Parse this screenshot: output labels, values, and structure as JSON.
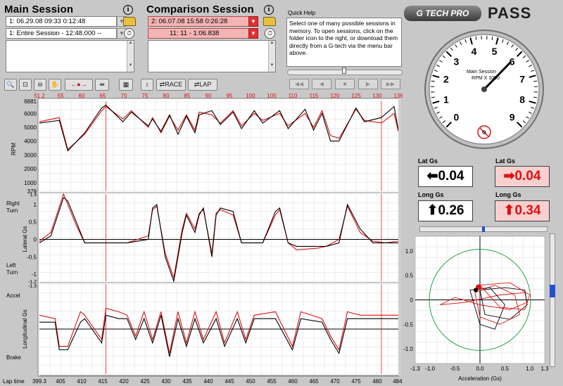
{
  "main_session": {
    "title": "Main Session",
    "session_value": "1:  06.29.08 09:33 0:12:48",
    "range_value": "1:  Entire Session - 12:48.000 --"
  },
  "comparison_session": {
    "title": "Comparison Session",
    "session_value": "2:  06.07.08 15:58 0:26:28",
    "range_value": "11:  11 - 1:06.838"
  },
  "quick_help": {
    "label": "Quick Help",
    "text": "Select one of many possible sessions in memory.  To open sessions, click on the folder icon to the right, or download them directly from a G-tech via the menu bar above."
  },
  "brand": {
    "logo": "G TECH PRO",
    "product": "PASS"
  },
  "toolbar": {
    "race_label": "RACE",
    "lap_label": "LAP"
  },
  "gauge": {
    "line1": "Main Session",
    "line2": "RPM X 1000",
    "ticks": [
      "0",
      "1",
      "2",
      "3",
      "4",
      "5",
      "6",
      "7",
      "8",
      "9"
    ]
  },
  "gs": {
    "lat_label": "Lat Gs",
    "long_label": "Long Gs",
    "main_lat": "0.04",
    "main_long": "0.26",
    "comp_lat": "0.04",
    "comp_long": "0.34",
    "colors": {
      "main": "#000000",
      "comparison": "#e01010"
    }
  },
  "top_axis": [
    "51.2",
    "55",
    "60",
    "65",
    "70",
    "75",
    "80",
    "85",
    "90",
    "95",
    "100",
    "105",
    "110",
    "115",
    "120",
    "125",
    "130",
    "136"
  ],
  "bottom_axis": [
    "399.3",
    "405",
    "410",
    "415",
    "420",
    "425",
    "430",
    "435",
    "440",
    "445",
    "450",
    "455",
    "460",
    "465",
    "470",
    "475",
    "480",
    "484."
  ],
  "bottom_axis_title": "Lap time",
  "rpm_panel": {
    "ylabel": "RPM",
    "ticks": [
      "6881",
      "6000",
      "5000",
      "4000",
      "3000",
      "2000",
      "1000",
      "379"
    ]
  },
  "lat_panel": {
    "ylabel": "Lateral Gs",
    "top_tick": "1.3",
    "bottom_tick": "-1.2",
    "ticks": [
      "1",
      "0.5",
      "0",
      "-0.5",
      "-1"
    ],
    "label_top_1": "Right",
    "label_top_2": "Turn",
    "label_bot_1": "Left",
    "label_bot_2": "Turn"
  },
  "long_panel": {
    "ylabel": "Longitudinal Gs",
    "top_tick": "-1.3",
    "label_top": "Accel",
    "label_bot": "Brake"
  },
  "friction_circle": {
    "xlabel": "Acceleration (Gs)",
    "xticks": [
      "-1.3",
      "-1.0",
      "-0.5",
      "0.0",
      "0.5",
      "1.0",
      "1.3"
    ],
    "yticks": [
      "1.0",
      "0.5",
      "0",
      "-0.5",
      "-1.0"
    ]
  },
  "chart_data": {
    "type": "line",
    "x_label": "Lap time",
    "x_range": [
      399.3,
      484
    ],
    "series": [
      {
        "name": "Main Session",
        "color": "#000000"
      },
      {
        "name": "Comparison Session",
        "color": "#e01010"
      }
    ],
    "rpm": {
      "ylim": [
        379,
        6881
      ],
      "x": [
        399.3,
        404,
        406,
        410,
        414,
        415,
        419,
        421,
        425,
        426,
        428,
        430,
        432,
        434,
        436,
        437,
        440,
        442,
        445,
        447,
        450,
        452,
        456,
        458,
        462,
        464,
        466,
        468,
        470,
        474,
        476,
        480,
        483,
        484
      ],
      "main": [
        5300,
        5500,
        3300,
        4600,
        6400,
        6600,
        5400,
        6100,
        5100,
        5600,
        4700,
        5900,
        4500,
        5800,
        4600,
        5900,
        6200,
        5200,
        6100,
        4900,
        6200,
        5300,
        6200,
        4900,
        6300,
        4800,
        6000,
        4000,
        4000,
        6400,
        5400,
        5700,
        6500,
        4800
      ],
      "comparison": [
        5400,
        5700,
        3400,
        4500,
        6200,
        6500,
        5600,
        6200,
        5000,
        5700,
        4600,
        5800,
        4800,
        5900,
        4800,
        6100,
        5900,
        5300,
        6200,
        5100,
        6000,
        5500,
        6000,
        5100,
        6000,
        5000,
        6200,
        4400,
        4200,
        6300,
        5500,
        5300,
        6000,
        4700
      ]
    },
    "lateral_gs": {
      "ylim": [
        -1.2,
        1.3
      ],
      "x": [
        399.3,
        402,
        405,
        406,
        408,
        410,
        414,
        420,
        425,
        426,
        427,
        429,
        431,
        433,
        434,
        436,
        437,
        438,
        440,
        441,
        442,
        445,
        447,
        450,
        452,
        455,
        456,
        458,
        460,
        465,
        467,
        470,
        472,
        475,
        478,
        481,
        484
      ],
      "main": [
        -0.1,
        0.1,
        1.2,
        1.1,
        0.5,
        -0.1,
        -0.1,
        -0.1,
        0,
        0.9,
        1.0,
        -0.5,
        -1.2,
        0.2,
        0.7,
        0.2,
        0.7,
        0.9,
        -0.5,
        0.7,
        0.9,
        0.8,
        -0.1,
        -0.1,
        -0.1,
        0.8,
        0.9,
        -0.1,
        -0.2,
        -0.2,
        -0.2,
        -0.1,
        1.0,
        0.3,
        -0.1,
        -0.1,
        -0.1
      ],
      "comparison": [
        -0.05,
        0.2,
        1.3,
        1.0,
        0.4,
        -0.1,
        -0.1,
        -0.1,
        0.1,
        0.85,
        0.95,
        -0.4,
        -1.1,
        0.3,
        0.75,
        0.3,
        0.75,
        0.85,
        -0.4,
        0.75,
        0.85,
        0.7,
        -0.1,
        -0.1,
        -0.1,
        0.7,
        0.85,
        -0.1,
        -0.3,
        -0.25,
        -0.2,
        0,
        0.95,
        0.2,
        -0.05,
        -0.1,
        -0.05
      ]
    },
    "longitudinal_gs": {
      "ylim": [
        -1.3,
        1.3
      ],
      "x": [
        399.3,
        403,
        404,
        406,
        409,
        410,
        414,
        415,
        418,
        420,
        422,
        424,
        426,
        428,
        430,
        432,
        434,
        436,
        438,
        441,
        443,
        446,
        448,
        450,
        455,
        459,
        461,
        466,
        468,
        470,
        472,
        475,
        478,
        480,
        484
      ],
      "main": [
        0.2,
        0.2,
        -0.6,
        -0.6,
        0.2,
        0.3,
        -0.4,
        0.4,
        0.3,
        0.3,
        -0.3,
        0.3,
        -0.4,
        0.4,
        -0.8,
        0.3,
        -0.5,
        0.3,
        -0.4,
        0.3,
        -0.5,
        0.3,
        -0.4,
        0.3,
        0.3,
        -0.6,
        0.3,
        0.2,
        -0.3,
        -0.7,
        0.3,
        0.3,
        0.3,
        0.3,
        0.3
      ],
      "comparison": [
        0.4,
        0.3,
        -0.5,
        -0.5,
        0.5,
        0.4,
        -0.3,
        0.6,
        0.5,
        0.4,
        -0.2,
        0.5,
        -0.3,
        0.5,
        -0.7,
        0.5,
        -0.4,
        0.5,
        -0.3,
        0.5,
        -0.4,
        0.5,
        -0.3,
        0.4,
        0.5,
        -0.5,
        0.5,
        0.3,
        -0.2,
        -0.6,
        0.5,
        0.4,
        0.4,
        0.4,
        0.4
      ]
    },
    "current_cursor_x": [
      415,
      480
    ]
  }
}
